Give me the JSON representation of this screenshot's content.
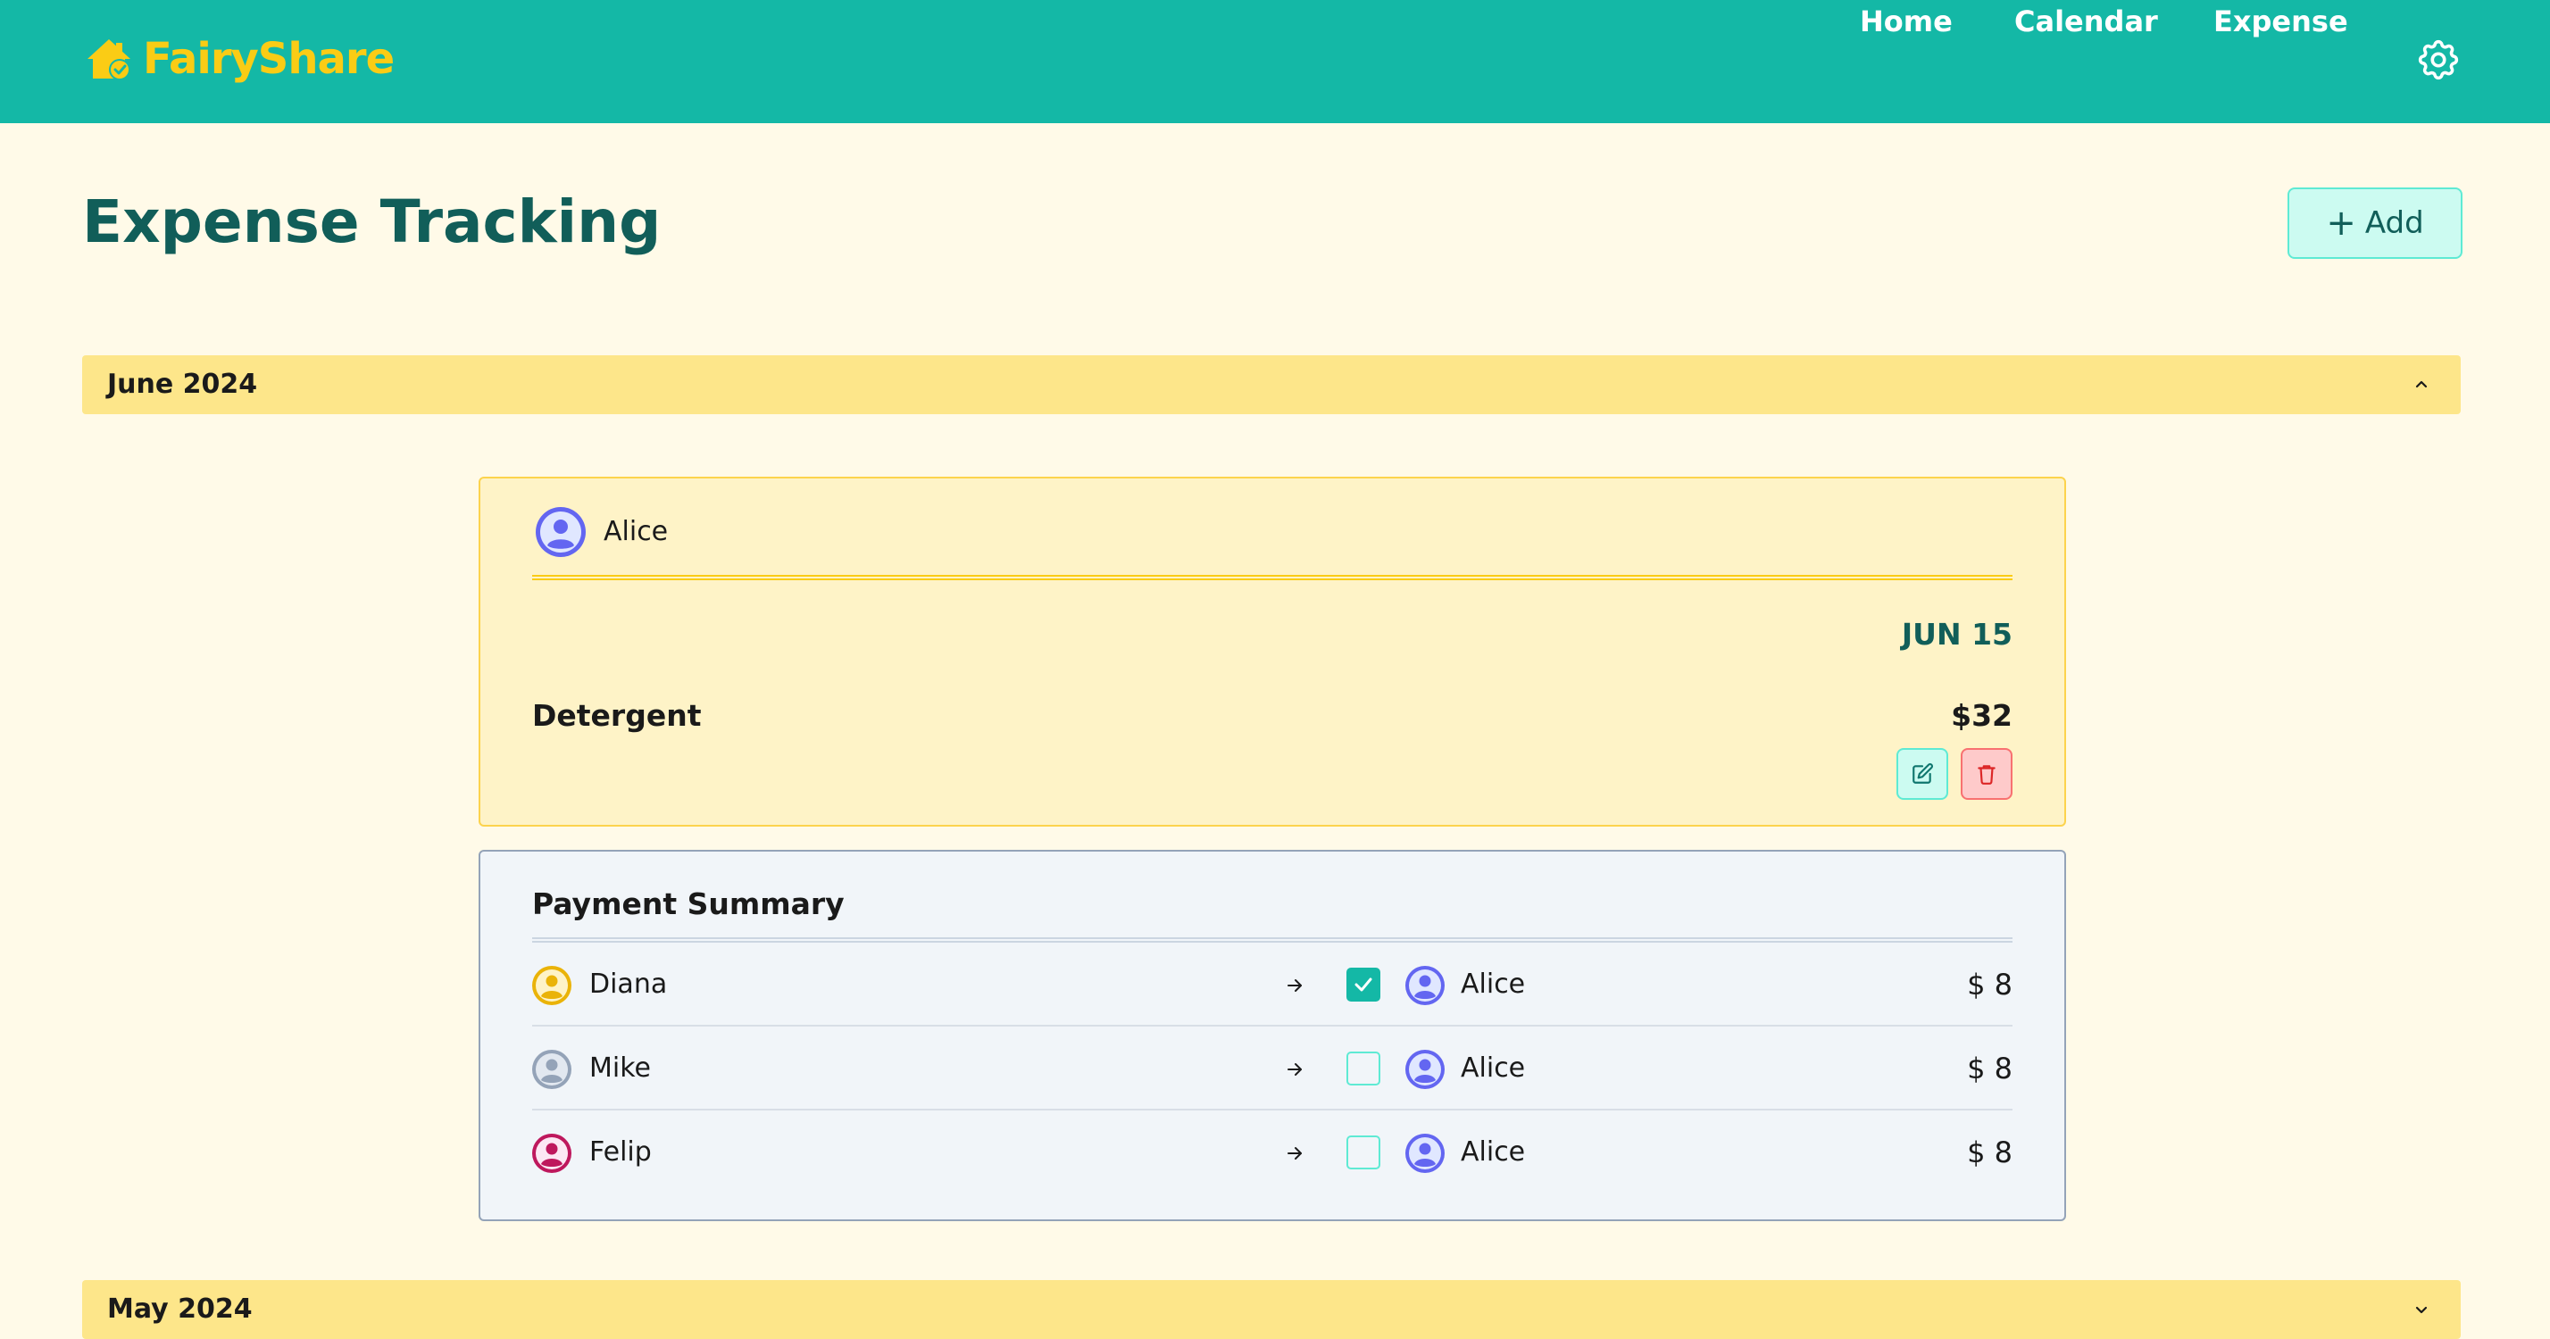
{
  "app": {
    "name": "FairyShare",
    "brand_color": "#14b8a6",
    "logo_color": "#facc15",
    "logo_icon": "house-check-icon"
  },
  "nav": {
    "items": [
      {
        "label": "Home"
      },
      {
        "label": "Calendar"
      },
      {
        "label": "Expense"
      }
    ],
    "settings_icon": "gear-icon"
  },
  "page": {
    "title": "Expense Tracking",
    "add_button": {
      "icon": "plus",
      "label": "Add"
    }
  },
  "months": [
    {
      "label": "June 2024",
      "expanded": true,
      "chevron": "chevron-up-icon",
      "expense": {
        "payer": {
          "name": "Alice",
          "avatar_color": "#6366f1"
        },
        "date": "JUN 15",
        "description": "Detergent",
        "amount": "$32",
        "actions": {
          "edit_icon": "edit-icon",
          "delete_icon": "trash-icon"
        }
      },
      "payment_summary": {
        "title": "Payment Summary",
        "rows": [
          {
            "from": "Diana",
            "from_color": "#eab308",
            "settled": true,
            "to": "Alice",
            "to_color": "#6366f1",
            "amount": "$ 8"
          },
          {
            "from": "Mike",
            "from_color": "#94a3b8",
            "settled": false,
            "to": "Alice",
            "to_color": "#6366f1",
            "amount": "$ 8"
          },
          {
            "from": "Felip",
            "from_color": "#be185d",
            "settled": false,
            "to": "Alice",
            "to_color": "#6366f1",
            "amount": "$ 8"
          }
        ]
      }
    },
    {
      "label": "May 2024",
      "expanded": false,
      "chevron": "chevron-down-icon"
    }
  ]
}
